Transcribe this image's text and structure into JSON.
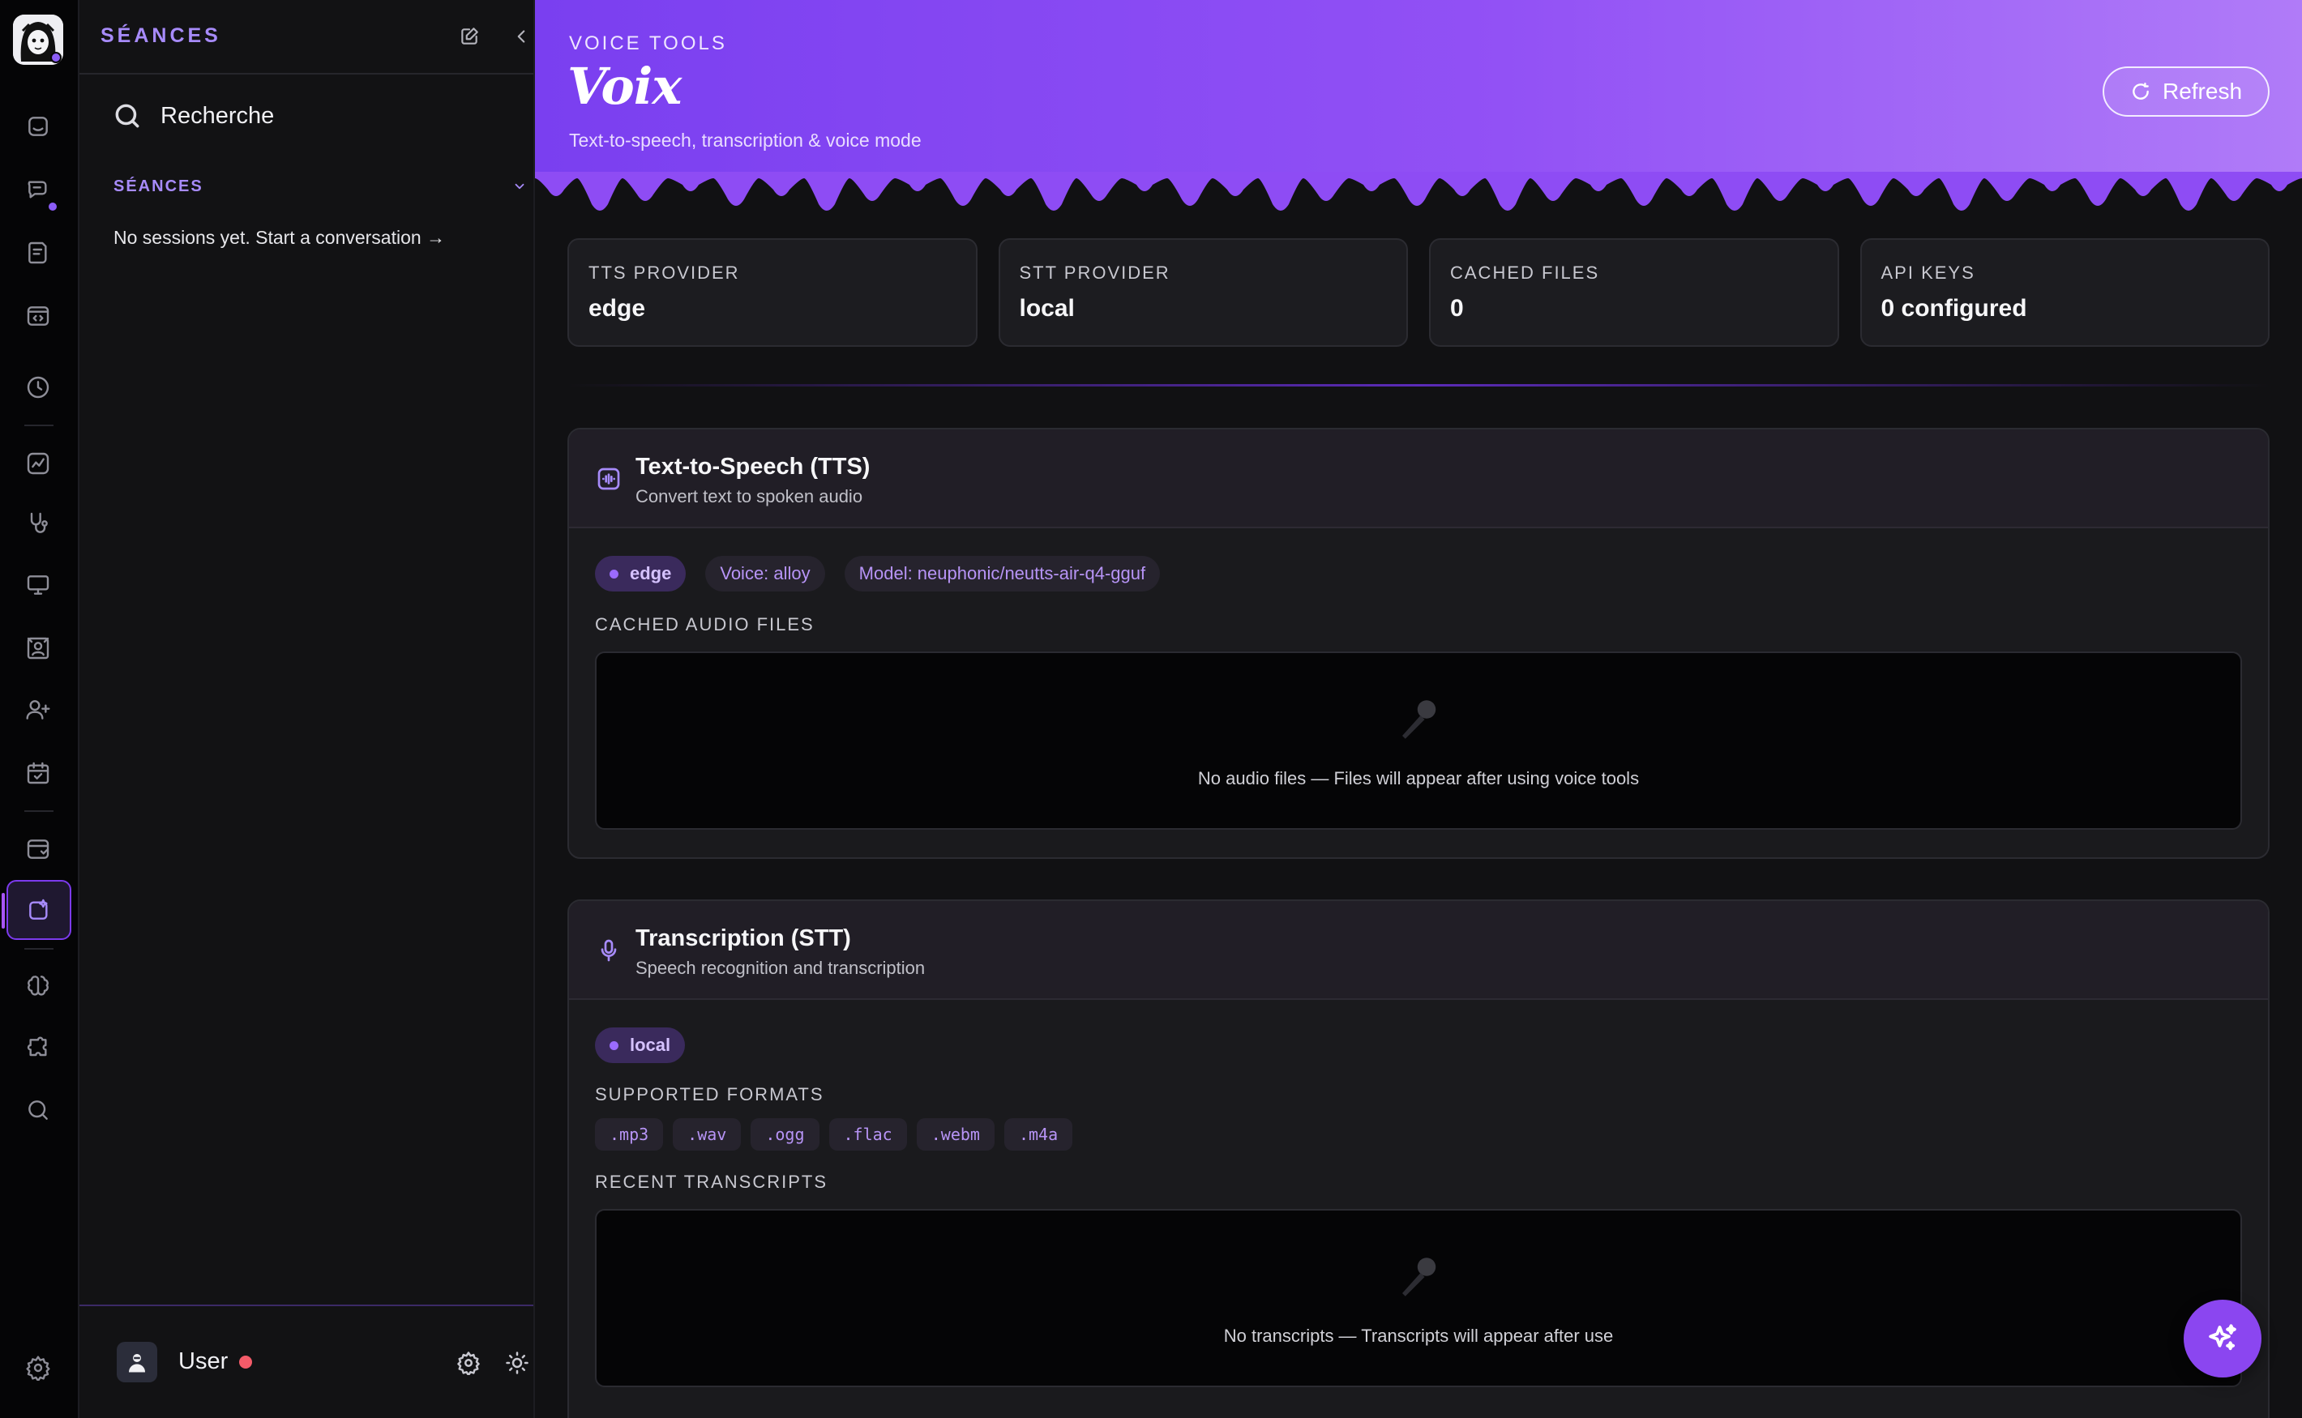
{
  "sidebar": {
    "title": "SÉANCES",
    "search_label": "Recherche",
    "section_label": "SÉANCES",
    "empty_text": "No sessions yet. Start a conversation →",
    "user_name": "User"
  },
  "hero": {
    "eyebrow": "VOICE TOOLS",
    "title": "Voix",
    "subtitle": "Text-to-speech, transcription & voice mode",
    "refresh_label": "Refresh"
  },
  "stats": [
    {
      "label": "TTS PROVIDER",
      "value": "edge"
    },
    {
      "label": "STT PROVIDER",
      "value": "local"
    },
    {
      "label": "CACHED FILES",
      "value": "0"
    },
    {
      "label": "API KEYS",
      "value": "0 configured"
    }
  ],
  "tts": {
    "title": "Text-to-Speech (TTS)",
    "subtitle": "Convert text to spoken audio",
    "provider_chip": "edge",
    "voice_chip": "Voice: alloy",
    "model_chip": "Model: neuphonic/neutts-air-q4-gguf",
    "cached_label": "CACHED AUDIO FILES",
    "empty_text": "No audio files — Files will appear after using voice tools"
  },
  "stt": {
    "title": "Transcription (STT)",
    "subtitle": "Speech recognition and transcription",
    "provider_chip": "local",
    "formats_label": "SUPPORTED FORMATS",
    "formats": [
      ".mp3",
      ".wav",
      ".ogg",
      ".flac",
      ".webm",
      ".m4a"
    ],
    "recent_label": "RECENT TRANSCRIPTS",
    "empty_text": "No transcripts — Transcripts will appear after use"
  },
  "icons": {
    "rail": [
      "home-icon",
      "chat-icon",
      "notes-icon",
      "code-icon",
      "clock-icon",
      "chart-icon",
      "stethoscope-icon",
      "monitor-icon",
      "gallery-icon",
      "user-add-icon",
      "calendar-icon",
      "browser-icon",
      "voice-icon",
      "brain-icon",
      "puzzle-icon",
      "search-icon",
      "settings-icon"
    ],
    "fab": "sparkles-icon"
  },
  "colors": {
    "accent": "#8b5cf6",
    "hero_start": "#7a3ff0",
    "hero_end": "#b07bf8",
    "status_offline": "#f45b69"
  }
}
